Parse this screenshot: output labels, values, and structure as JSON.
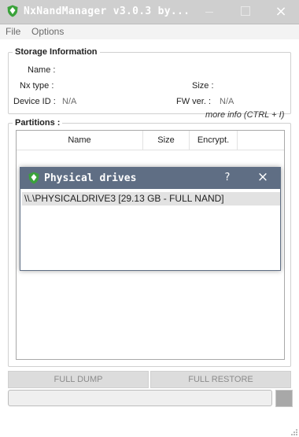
{
  "window": {
    "title": "NxNandManager v3.0.3 by...",
    "icon": "shield-logo-icon",
    "controls": {
      "minimize": "minimize-icon",
      "maximize": "maximize-icon",
      "close": "×"
    }
  },
  "menu": {
    "file": "File",
    "options": "Options"
  },
  "storage": {
    "title": "Storage Information",
    "name_label": "Name :",
    "nx_type_label": "Nx type :",
    "size_label": "Size :",
    "device_id_label": "Device ID :",
    "device_id_value": "N/A",
    "fw_label": "FW ver. :",
    "fw_value": "N/A",
    "more_info": "more info (CTRL + I)"
  },
  "partitions": {
    "title": "Partitions :",
    "columns": [
      "Name",
      "Size",
      "Encrypt."
    ]
  },
  "buttons": {
    "full_dump": "FULL DUMP",
    "full_restore": "FULL RESTORE"
  },
  "dialog": {
    "title": "Physical drives",
    "help": "?",
    "close": "×",
    "drives": [
      "\\\\.\\PHYSICALDRIVE3 [29.13 GB - FULL NAND]"
    ]
  },
  "colors": {
    "logo_green": "#3aa23a",
    "dialog_titlebar": "#5f6e84",
    "main_titlebar": "#cfcfcf"
  }
}
